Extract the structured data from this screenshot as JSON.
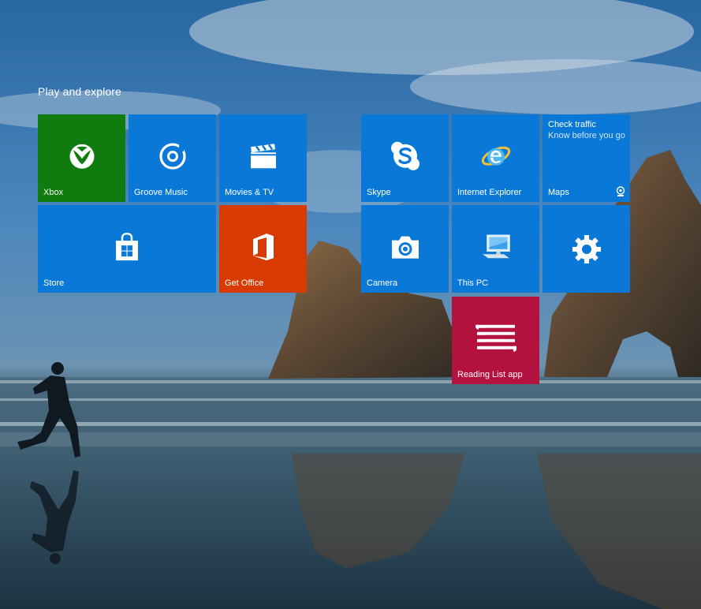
{
  "group": {
    "title": "Play and explore"
  },
  "colors": {
    "blue": "#0a78d7",
    "green": "#107c10",
    "office_orange": "#d83b01",
    "reading_red": "#b3123e"
  },
  "tiles": {
    "xbox": {
      "label": "Xbox",
      "icon": "xbox-icon"
    },
    "groove": {
      "label": "Groove Music",
      "icon": "groove-music-icon"
    },
    "movies": {
      "label": "Movies & TV",
      "icon": "clapperboard-icon"
    },
    "skype": {
      "label": "Skype",
      "icon": "skype-icon"
    },
    "ie": {
      "label": "Internet Explorer",
      "icon": "internet-explorer-icon"
    },
    "maps": {
      "label": "Maps",
      "live_title": "Check traffic",
      "live_subtitle": "Know before you go",
      "icon": "webcam-badge-icon"
    },
    "store": {
      "label": "Store",
      "icon": "store-bag-icon"
    },
    "office": {
      "label": "Get Office",
      "icon": "office-icon"
    },
    "camera": {
      "label": "Camera",
      "icon": "camera-icon"
    },
    "thispc": {
      "label": "This PC",
      "icon": "computer-icon"
    },
    "settings": {
      "label": "",
      "icon": "gear-icon"
    },
    "reading": {
      "label": "Reading List app",
      "icon": "reading-list-icon"
    }
  }
}
